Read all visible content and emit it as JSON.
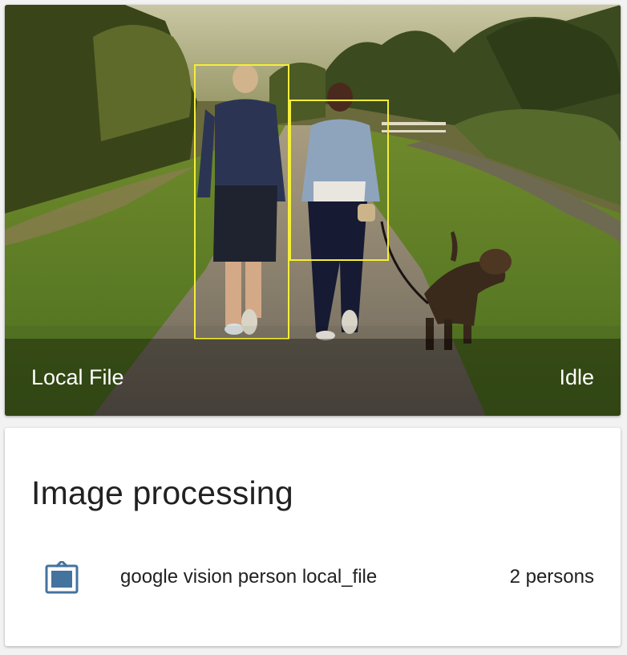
{
  "camera": {
    "name": "Local File",
    "state": "Idle",
    "detections": [
      {
        "label": "person"
      },
      {
        "label": "person"
      }
    ],
    "box_color": "#f4ee3a"
  },
  "processing": {
    "title": "Image processing",
    "entity": {
      "icon": "image-frame-icon",
      "name": "google vision person local_file",
      "state": "2 persons"
    },
    "icon_color": "#44739e"
  }
}
